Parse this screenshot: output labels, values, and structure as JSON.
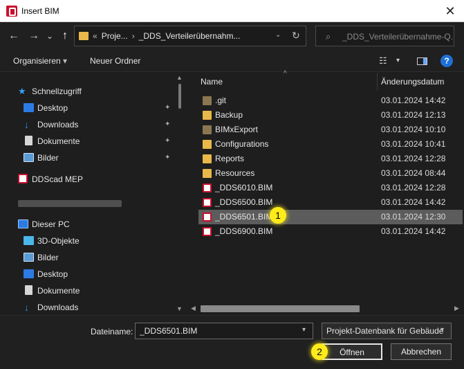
{
  "window": {
    "title": "Insert BIM",
    "close_label": "✕"
  },
  "nav": {
    "back": "←",
    "forward": "→",
    "recent": "⌄",
    "up": "↑",
    "breadcrumb": [
      "«",
      "Proje...",
      "›",
      "_DDS_Verteilerübernahm..."
    ],
    "dropdown": "⌄",
    "refresh": "↻",
    "search_placeholder": "_DDS_Verteilerübernahme-Q..."
  },
  "toolbar": {
    "organize": "Organisieren",
    "organize_arrow": "▾",
    "new_folder": "Neuer Ordner",
    "view_arrow": "▾",
    "help": "?"
  },
  "sidebar": {
    "items": [
      {
        "label": "Schnellzugriff",
        "icon": "star-icon"
      },
      {
        "label": "Desktop",
        "icon": "desktop-icon",
        "pinned": true
      },
      {
        "label": "Downloads",
        "icon": "download-icon",
        "pinned": true
      },
      {
        "label": "Dokumente",
        "icon": "document-icon",
        "pinned": true
      },
      {
        "label": "Bilder",
        "icon": "pictures-icon",
        "pinned": true
      },
      {
        "label": "DDScad MEP",
        "icon": "ddscad-icon"
      },
      {
        "label": "Dieser PC",
        "icon": "pc-icon"
      },
      {
        "label": "3D-Objekte",
        "icon": "cube-icon"
      },
      {
        "label": "Bilder",
        "icon": "pictures-icon"
      },
      {
        "label": "Desktop",
        "icon": "desktop-icon"
      },
      {
        "label": "Dokumente",
        "icon": "document-icon"
      },
      {
        "label": "Downloads",
        "icon": "download-icon"
      }
    ],
    "pin_glyph": "📌",
    "scroll_up": "▲",
    "scroll_down": "▼"
  },
  "files": {
    "columns": {
      "name": "Name",
      "date": "Änderungsdatum",
      "sort_arrow": "^"
    },
    "rows": [
      {
        "name": ".git",
        "date": "03.01.2024 14:42",
        "type": "folder-gray"
      },
      {
        "name": "Backup",
        "date": "03.01.2024 12:13",
        "type": "folder"
      },
      {
        "name": "BIMxExport",
        "date": "03.01.2024 10:10",
        "type": "folder-gray"
      },
      {
        "name": "Configurations",
        "date": "03.01.2024 10:41",
        "type": "folder"
      },
      {
        "name": "Reports",
        "date": "03.01.2024 12:28",
        "type": "folder"
      },
      {
        "name": "Resources",
        "date": "03.01.2024 08:44",
        "type": "folder"
      },
      {
        "name": "_DDS6010.BIM",
        "date": "03.01.2024 12:28",
        "type": "bim"
      },
      {
        "name": "_DDS6500.BIM",
        "date": "03.01.2024 14:42",
        "type": "bim"
      },
      {
        "name": "_DDS6501.BIM",
        "date": "03.01.2024 12:30",
        "type": "bim",
        "selected": true
      },
      {
        "name": "_DDS6900.BIM",
        "date": "03.01.2024 14:42",
        "type": "bim"
      }
    ],
    "hscroll_left": "◀",
    "hscroll_right": "▶"
  },
  "bottom": {
    "filename_label": "Dateiname:",
    "filename_value": "_DDS6501.BIM",
    "filename_arrow": "▾",
    "filetype": "Projekt-Datenbank für Gebäude",
    "filetype_arrow": "▾",
    "open": "Öffnen",
    "cancel": "Abbrechen"
  },
  "badges": [
    "1",
    "2"
  ],
  "colors": {
    "accent_bim": "#c8102e",
    "folder": "#e8b84a",
    "badge": "#ffeb1a",
    "selection": "#5c5c5c"
  }
}
